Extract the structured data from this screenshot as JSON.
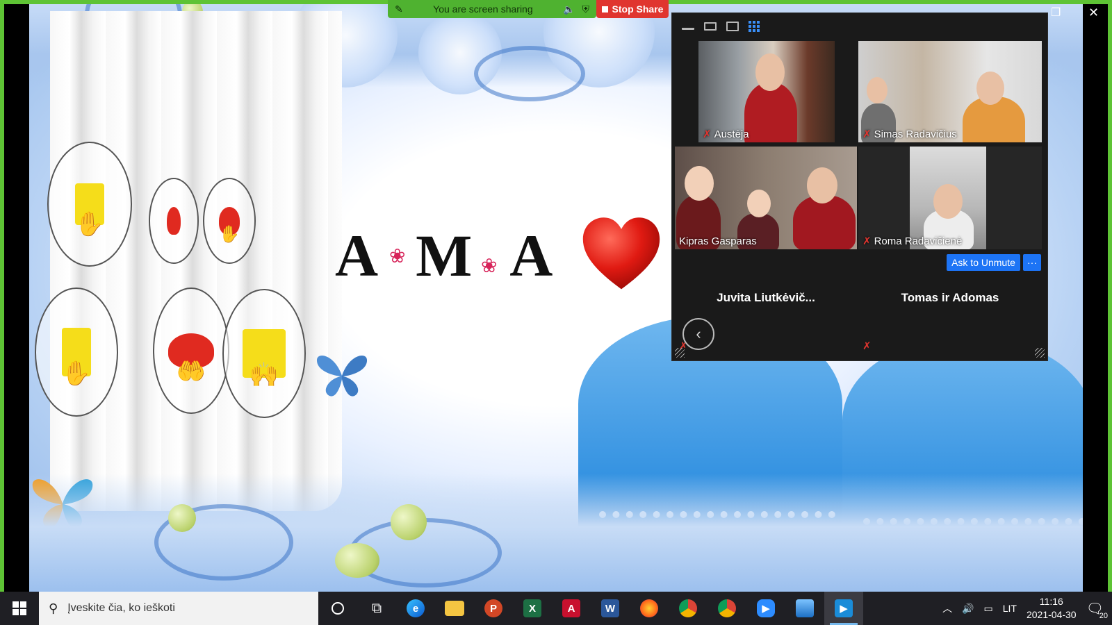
{
  "share_toolbar": {
    "status": "You are screen sharing",
    "stop_label": "Stop Share"
  },
  "slide": {
    "word": "AMA"
  },
  "participants": [
    {
      "name": "Austėja",
      "muted": true
    },
    {
      "name": "Simas Radavičius",
      "muted": true
    },
    {
      "name": "Kipras Gasparas",
      "muted": false
    },
    {
      "name": "Roma Radavičienė",
      "muted": true
    },
    {
      "name": "Juvita  Liutkėvič...",
      "muted": true
    },
    {
      "name": "Tomas ir Adomas",
      "muted": true
    }
  ],
  "actions": {
    "ask_unmute": "Ask to Unmute",
    "more": "···"
  },
  "taskbar": {
    "search_placeholder": "Įveskite čia, ko ieškoti",
    "apps": [
      "cortana-icon",
      "task-view-icon",
      "edge-icon",
      "file-explorer-icon",
      "powerpoint-icon",
      "excel-icon",
      "acrobat-icon",
      "word-icon",
      "firefox-icon",
      "chrome-icon",
      "chrome-icon",
      "zoom-icon",
      "photos-icon",
      "media-player-icon"
    ],
    "language": "LIT",
    "time": "11:16",
    "date": "2021-04-30",
    "notifications": "20"
  },
  "colors": {
    "share_green": "#5ec335",
    "stop_red": "#e0352f",
    "zoom_blue": "#1d74f5",
    "taskbar": "#1f1f24"
  }
}
